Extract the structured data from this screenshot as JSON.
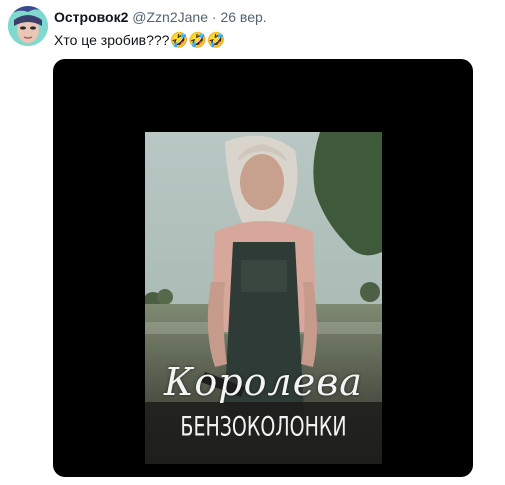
{
  "tweet": {
    "author_name": "Островок2",
    "handle": "@Zzn2Jane",
    "separator": "·",
    "date": "26 вер.",
    "text": "Хто це зробив???",
    "emojis": "🤣🤣🤣"
  },
  "media": {
    "poster_title_line1": "Королева",
    "poster_title_line2": "БЕНЗОКОЛОНКИ"
  },
  "icons": {
    "avatar": "avatar-image",
    "emoji": "rolling-on-floor-laughing-emoji"
  }
}
